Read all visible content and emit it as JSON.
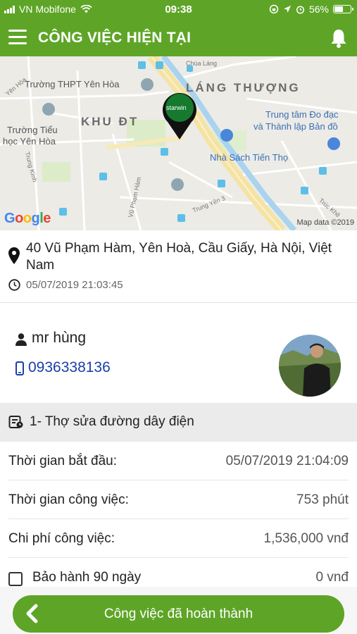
{
  "status_bar": {
    "carrier": "VN Mobifone",
    "time": "09:38",
    "battery_text": "56%",
    "battery_level": 0.56
  },
  "header": {
    "title": "CÔNG VIỆC HIỆN TẠI"
  },
  "map": {
    "marker_label": "starwin",
    "labels": {
      "school_yenhoa": "Trường THPT Yên Hòa",
      "khu_dt": "KHU ĐT",
      "lang_thuong": "LÁNG THƯỢNG",
      "chua_lang": "Chùa Láng",
      "center_line1": "Trung tâm Đo đạc",
      "center_line2": "và Thành lập Bản đồ",
      "school_tieuhoc1": "Trường Tiểu",
      "school_tieuhoc2": "học Yên Hòa",
      "bookstore": "Nhà Sách Tiến Thọ",
      "yen_hoa": "Yên Hòa",
      "trung_kinh": "Trung Kính",
      "vu_pham_ham": "Vũ Phạm Hàm",
      "trung_yen": "Trung Yên 3",
      "truc_khe": "Trúc Khê"
    },
    "attribution": "Map data ©2019",
    "logo": "Google"
  },
  "job": {
    "address": "40 Vũ Phạm Hàm, Yên Hoà, Cầu Giấy, Hà Nội, Việt Nam",
    "created_at": "05/07/2019 21:03:45"
  },
  "customer": {
    "name": "mr hùng",
    "phone": "0936338136"
  },
  "service": {
    "title": "1- Thợ sửa đường dây điện"
  },
  "details": [
    {
      "label": "Thời gian bắt đầu:",
      "value": "05/07/2019 21:04:09"
    },
    {
      "label": "Thời gian công việc:",
      "value": "753 phút"
    },
    {
      "label": "Chi phí công việc:",
      "value": "1,536,000 vnđ"
    }
  ],
  "warranty": {
    "label": "Bảo hành 90 ngày",
    "value": "0 vnđ",
    "checked": false
  },
  "actions": {
    "done_label": "Công việc đã hoàn thành"
  },
  "colors": {
    "primary_green": "#5ea527",
    "phone_blue": "#1a3fa8"
  }
}
